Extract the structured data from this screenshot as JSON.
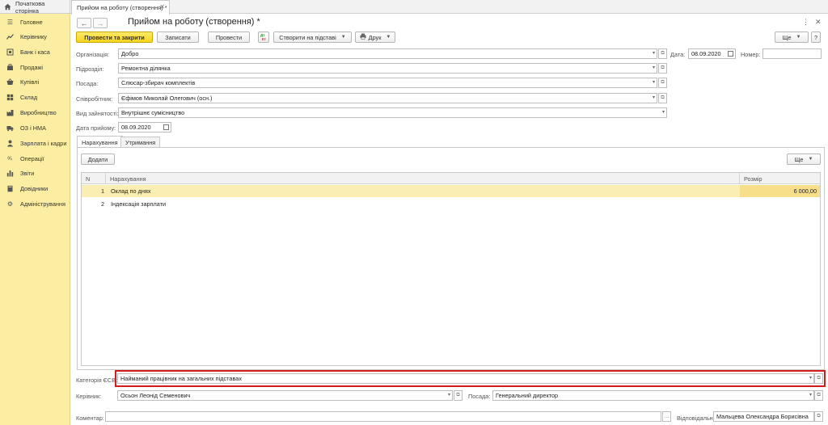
{
  "tabs": {
    "home_label": "Початкова сторінка",
    "doc_label": "Прийом на роботу (створення) *"
  },
  "sidebar": {
    "items": [
      {
        "label": "Головне",
        "icon": "menu-icon"
      },
      {
        "label": "Керівнику",
        "icon": "chart-icon"
      },
      {
        "label": "Банк і каса",
        "icon": "bank-icon"
      },
      {
        "label": "Продажі",
        "icon": "cart-icon"
      },
      {
        "label": "Купівлі",
        "icon": "basket-icon"
      },
      {
        "label": "Склад",
        "icon": "warehouse-icon"
      },
      {
        "label": "Виробництво",
        "icon": "factory-icon"
      },
      {
        "label": "ОЗ і НМА",
        "icon": "truck-icon"
      },
      {
        "label": "Зарплата і кадри",
        "icon": "person-icon"
      },
      {
        "label": "Операції",
        "icon": "operations-icon"
      },
      {
        "label": "Звіти",
        "icon": "bars-icon"
      },
      {
        "label": "Довідники",
        "icon": "book-icon"
      },
      {
        "label": "Адміністрування",
        "icon": "gear-icon"
      }
    ]
  },
  "header": {
    "title": "Прийом на роботу (створення) *"
  },
  "toolbar": {
    "post_close": "Провести та закрити",
    "save": "Записати",
    "post": "Провести",
    "create_based": "Створити на підставі",
    "print": "Друк",
    "more": "Ще"
  },
  "form": {
    "org_label": "Організація:",
    "org_value": "Добро",
    "date_label": "Дата:",
    "date_value": "08.09.2020",
    "number_label": "Номер:",
    "number_value": "",
    "dept_label": "Підрозділ:",
    "dept_value": "Ремонтна ділянка",
    "position_label": "Посада:",
    "position_value": "Слюсар-збирач комплектів",
    "employee_label": "Співробітник:",
    "employee_value": "Єфімов Миколай Олегович (осн.)",
    "employment_label": "Вид зайнятості:",
    "employment_value": "Внутрішнє сумісництво",
    "hire_date_label": "Дата прийому:",
    "hire_date_value": "08.09.2020"
  },
  "inner_tabs": [
    "Нарахування",
    "Утримання"
  ],
  "grid": {
    "add_label": "Додати",
    "more_label": "Ще",
    "columns": [
      "N",
      "Нарахування",
      "Розмір"
    ],
    "rows": [
      {
        "n": "1",
        "name": "Оклад по днях",
        "amount": "6 000,00"
      },
      {
        "n": "2",
        "name": "Індексація зарплати",
        "amount": ""
      }
    ]
  },
  "footer": {
    "esv_label": "Категорія ЄСВ:",
    "esv_value": "Найманий працівник на загальних підставах",
    "manager_label": "Керівник:",
    "manager_value": "Осьон Леонід Семенович",
    "manager_pos_label": "Посада:",
    "manager_pos_value": "Генеральний директор",
    "comment_label": "Коментар:",
    "comment_value": "",
    "responsible_label": "Відповідальний:",
    "responsible_value": "Мальцева Олександра Борисівна"
  },
  "colors": {
    "sidebar_bg": "#fbeea3",
    "primary_button": "#f5d41c",
    "selected_row": "#fbeeb2",
    "highlight_border": "#d01c1c"
  }
}
